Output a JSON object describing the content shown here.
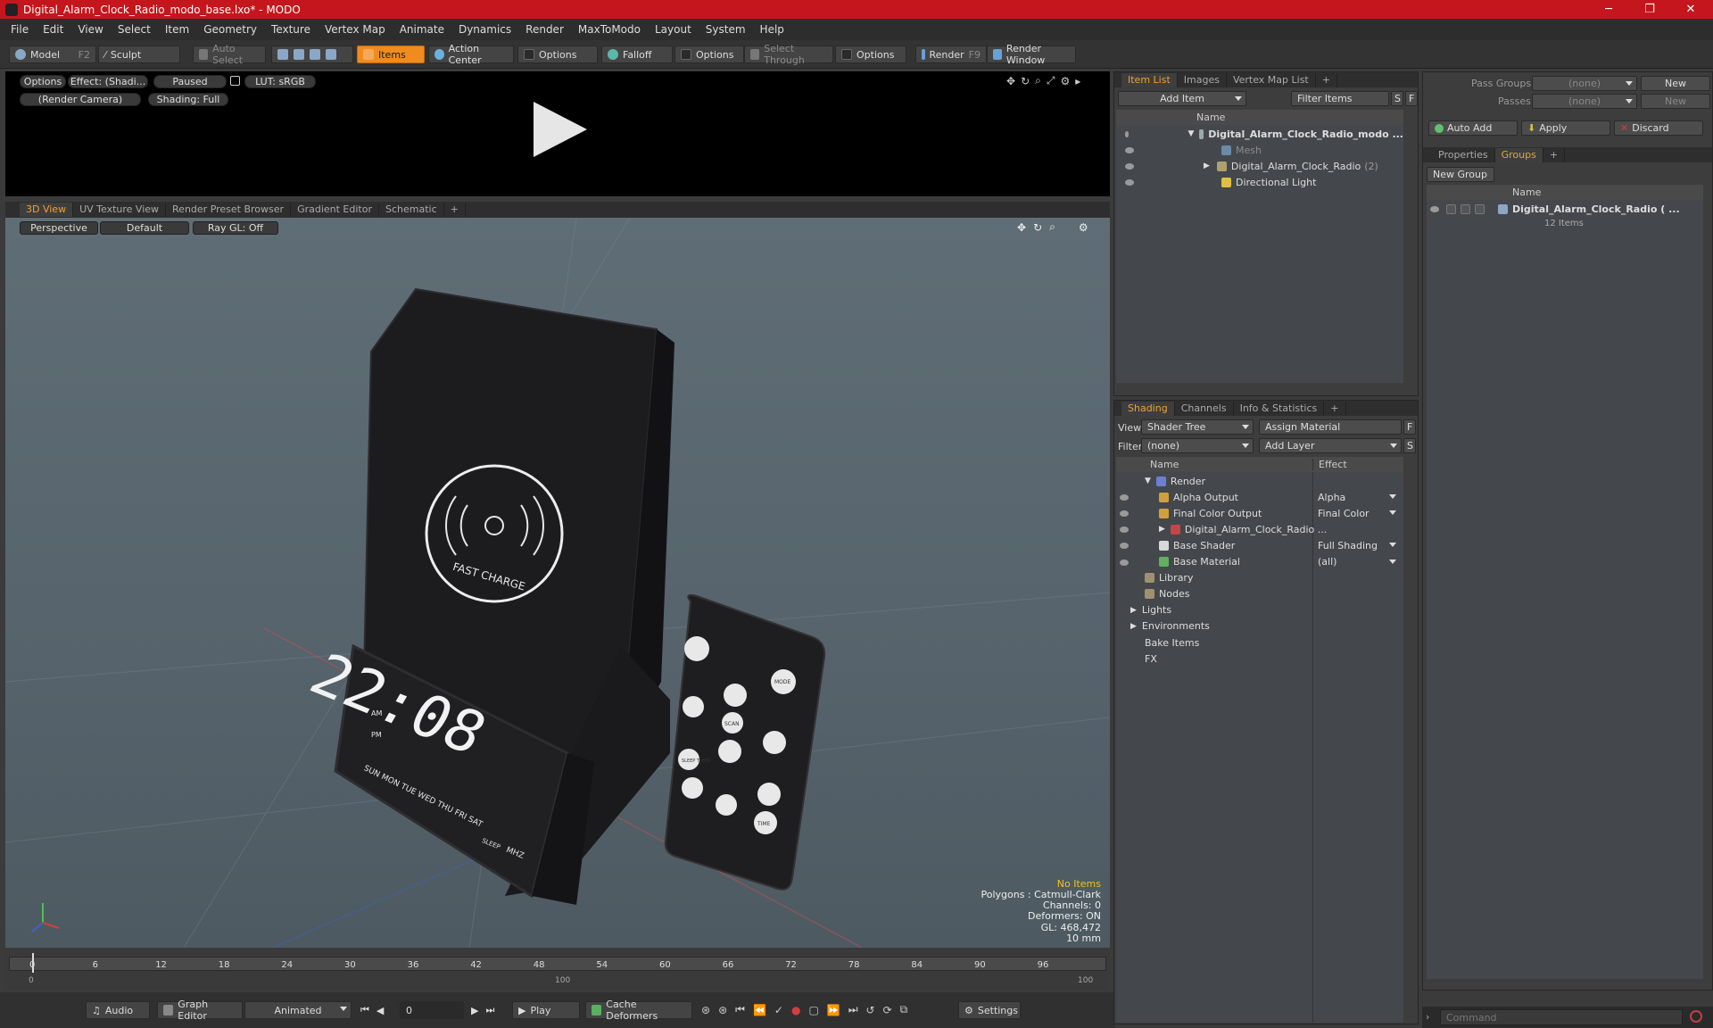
{
  "window": {
    "title": "Digital_Alarm_Clock_Radio_modo_base.lxo* - MODO",
    "controls": [
      "─",
      "❐",
      "✕"
    ]
  },
  "menu": [
    "File",
    "Edit",
    "View",
    "Select",
    "Item",
    "Geometry",
    "Texture",
    "Vertex Map",
    "Animate",
    "Dynamics",
    "Render",
    "MaxToModo",
    "Layout",
    "System",
    "Help"
  ],
  "toolbar": {
    "model": "Model",
    "model_key": "F2",
    "sculpt": "Sculpt",
    "auto_select": "Auto Select",
    "items": "Items",
    "action_center": "Action Center",
    "options1": "Options",
    "falloff": "Falloff",
    "options2": "Options",
    "select_through": "Select Through",
    "options3": "Options",
    "render": "Render",
    "render_key": "F9",
    "render_window": "Render Window"
  },
  "preview": {
    "options": "Options",
    "effect": "Effect: (Shadi...",
    "paused": "Paused",
    "lut": "LUT: sRGB",
    "camera": "(Render Camera)",
    "shading": "Shading: Full"
  },
  "view_tabs": [
    "3D View",
    "UV Texture View",
    "Render Preset Browser",
    "Gradient Editor",
    "Schematic",
    "+"
  ],
  "viewport": {
    "perspective": "Perspective",
    "default": "Default",
    "raygl": "Ray GL: Off",
    "clock_time": "22:08",
    "charge_label": "FAST CHARGE",
    "days": "SUN MON TUE WED THU FRI SAT",
    "sleep": "SLEEP",
    "mhz": "MHZ",
    "am": "AM",
    "pm": "PM",
    "remote_mode": "MODE",
    "remote_time": "TIME",
    "remote_scan": "SCAN",
    "remote_sleep": "SLEEP TIMER",
    "info": {
      "no_items": "No Items",
      "polygons": "Polygons : Catmull-Clark",
      "channels": "Channels: 0",
      "deformers": "Deformers: ON",
      "gl": "GL: 468,472",
      "unit": "10 mm"
    }
  },
  "timeline": {
    "ticks": [
      "0",
      "6",
      "12",
      "18",
      "24",
      "30",
      "36",
      "42",
      "48",
      "54",
      "60",
      "66",
      "72",
      "78",
      "84",
      "90",
      "96"
    ],
    "sub_ticks": [
      "0",
      "100",
      "100"
    ]
  },
  "bottombar": {
    "audio": "Audio",
    "graph_editor": "Graph Editor",
    "animated": "Animated",
    "frame": "0",
    "play": "Play",
    "cache_deformers": "Cache Deformers",
    "settings": "Settings",
    "command_placeholder": "Command"
  },
  "item_list": {
    "tabs": [
      "Item List",
      "Images",
      "Vertex Map List",
      "+"
    ],
    "add_item": "Add Item",
    "filter_items": "Filter Items",
    "s": "S",
    "f": "F",
    "col_name": "Name",
    "rows": [
      {
        "label": "Digital_Alarm_Clock_Radio_modo ...",
        "bold": true
      },
      {
        "label": "Mesh",
        "dim": true
      },
      {
        "label": "Digital_Alarm_Clock_Radio",
        "count": "(2)"
      },
      {
        "label": "Directional Light"
      }
    ]
  },
  "shading": {
    "tabs": [
      "Shading",
      "Channels",
      "Info & Statistics",
      "+"
    ],
    "view_label": "View",
    "view_value": "Shader Tree",
    "assign_material": "Assign Material",
    "filter_label": "Filter",
    "filter_value": "(none)",
    "add_layer": "Add Layer",
    "f": "F",
    "s": "S",
    "col_name": "Name",
    "col_effect": "Effect",
    "rows": [
      {
        "label": "Render",
        "effect": ""
      },
      {
        "label": "Alpha Output",
        "effect": "Alpha"
      },
      {
        "label": "Final Color Output",
        "effect": "Final Color"
      },
      {
        "label": "Digital_Alarm_Clock_Radio ...",
        "effect": ""
      },
      {
        "label": "Base Shader",
        "effect": "Full Shading"
      },
      {
        "label": "Base Material",
        "effect": "(all)"
      },
      {
        "label": "Library",
        "effect": ""
      },
      {
        "label": "Nodes",
        "effect": ""
      },
      {
        "label": "Lights",
        "effect": ""
      },
      {
        "label": "Environments",
        "effect": ""
      },
      {
        "label": "Bake Items",
        "effect": ""
      },
      {
        "label": "FX",
        "effect": ""
      }
    ]
  },
  "groups": {
    "pass_groups_label": "Pass Groups",
    "pass_groups_value": "(none)",
    "passes_label": "Passes",
    "passes_value": "(none)",
    "new1": "New",
    "new2": "New",
    "auto_add": "Auto Add",
    "apply": "Apply",
    "discard": "Discard",
    "tabs": [
      "Properties",
      "Groups",
      "+"
    ],
    "new_group": "New Group",
    "col_name": "Name",
    "group_name": "Digital_Alarm_Clock_Radio ( ...",
    "group_count": "12 Items"
  },
  "colors": {
    "accent": "#f08c1e",
    "title_bar": "#c4161c",
    "info_highlight": "#f0c020"
  }
}
